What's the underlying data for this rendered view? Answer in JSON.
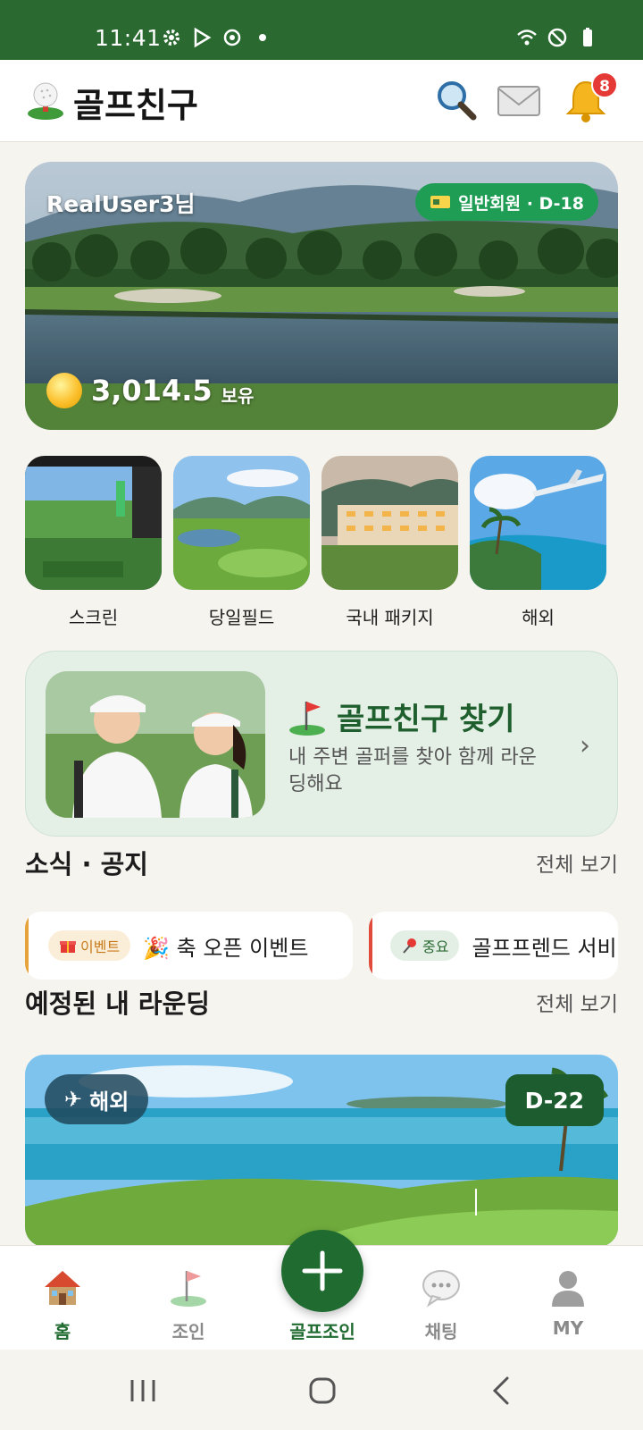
{
  "status_bar": {
    "time": "11:41",
    "left_icons": [
      "settings-icon",
      "play-store-icon",
      "sync-icon",
      "dot-icon"
    ],
    "right_icons": [
      "wifi-icon",
      "do-not-disturb-icon",
      "battery-icon"
    ]
  },
  "header": {
    "title": "골프친구",
    "notification_count": "8",
    "icons": [
      "golf-ball-logo-icon",
      "search-icon",
      "mail-icon",
      "bell-icon"
    ]
  },
  "hero": {
    "user_name": "RealUser3님",
    "membership": "일반회원 · D-18",
    "points": "3,014.5",
    "points_unit": "보유"
  },
  "categories": [
    {
      "label": "스크린"
    },
    {
      "label": "당일필드"
    },
    {
      "label": "국내 패키지"
    },
    {
      "label": "해외"
    }
  ],
  "friend_banner": {
    "title": "골프친구 찾기",
    "subtitle": "내 주변 골퍼를 찾아 함께 라운딩해요"
  },
  "news": {
    "title": "소식 · 공지",
    "more": "전체 보기",
    "items": [
      {
        "tag": "이벤트",
        "text": "🎉 축 오픈 이벤트"
      },
      {
        "tag": "중요",
        "text": "골프프렌드 서비"
      }
    ]
  },
  "rounding": {
    "title": "예정된 내 라운딩",
    "more": "전체 보기",
    "card": {
      "tag": "해외",
      "dday": "D-22"
    }
  },
  "bottom_nav": {
    "items": [
      {
        "label": "홈"
      },
      {
        "label": "조인"
      },
      {
        "label": "골프조인"
      },
      {
        "label": "채팅"
      },
      {
        "label": "MY"
      }
    ],
    "active": "홈"
  },
  "colors": {
    "brand_green": "#1f6b30",
    "status_bar": "#2a6a30",
    "member_pill": "#1f9d55",
    "badge_red": "#e53935"
  }
}
